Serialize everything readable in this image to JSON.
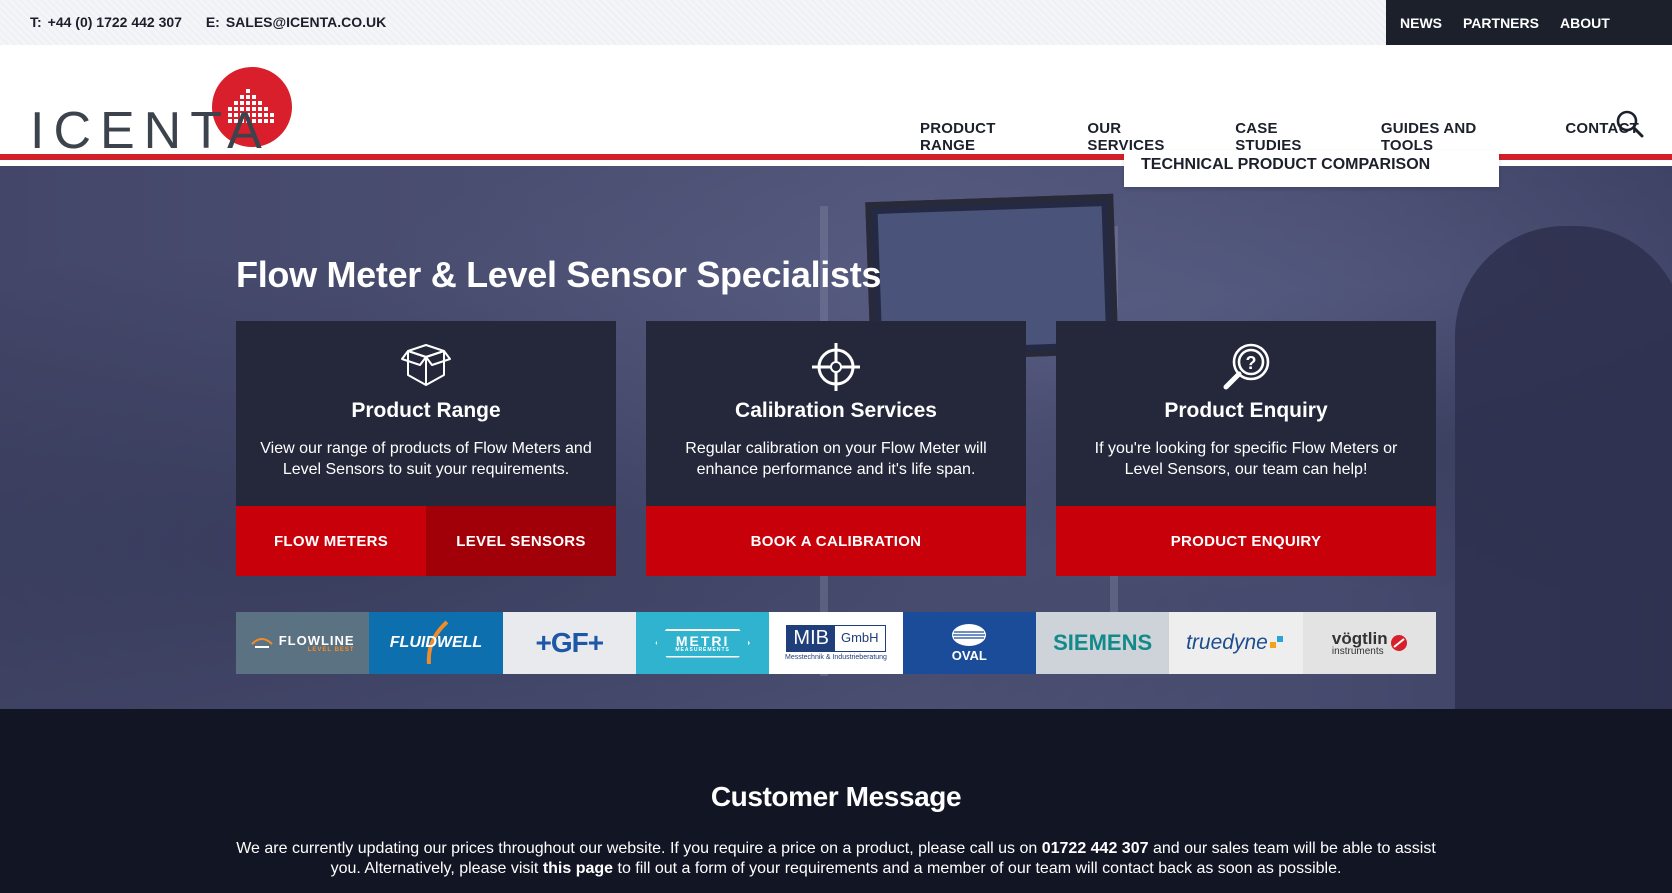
{
  "topbar": {
    "phone_label": "T:",
    "phone": "+44 (0) 1722 442 307",
    "email_label": "E:",
    "email": "SALES@ICENTA.CO.UK",
    "links": [
      "NEWS",
      "PARTNERS",
      "ABOUT"
    ]
  },
  "header": {
    "logo_text": "ICENTA",
    "nav": [
      "PRODUCT RANGE",
      "OUR SERVICES",
      "CASE STUDIES",
      "GUIDES AND TOOLS",
      "CONTACT"
    ],
    "dropdown_item": "TECHNICAL PRODUCT COMPARISON",
    "brand_color": "#d0202a"
  },
  "hero": {
    "title": "Flow Meter & Level Sensor Specialists",
    "cards": [
      {
        "icon": "box-icon",
        "title": "Product Range",
        "text": "View our range of products of Flow Meters and Level Sensors to suit your requirements.",
        "buttons": [
          "FLOW METERS",
          "LEVEL SENSORS"
        ]
      },
      {
        "icon": "crosshair-icon",
        "title": "Calibration Services",
        "text": "Regular calibration on your Flow Meter will enhance performance and it's life span.",
        "buttons": [
          "BOOK A CALIBRATION"
        ]
      },
      {
        "icon": "magnifier-question-icon",
        "title": "Product Enquiry",
        "text": "If you're looking for specific Flow Meters or Level Sensors, our team can help!",
        "buttons": [
          "PRODUCT ENQUIRY"
        ]
      }
    ],
    "partners": [
      {
        "name": "FLOWLINE",
        "sub": "LEVEL BEST",
        "bg": "#5b7283",
        "fg": "#ffffff"
      },
      {
        "name": "FLUIDWELL",
        "bg": "#0e6fae",
        "fg": "#ffffff"
      },
      {
        "name": "+GF+",
        "bg": "#e8eaee",
        "fg": "#1d58a6"
      },
      {
        "name": "METRI",
        "sub": "MEASUREMENTS",
        "bg": "#2fb3cf",
        "fg": "#ffffff"
      },
      {
        "name": "MIB",
        "tag": "GmbH",
        "sub": "Messtechnik & Industrieberatung",
        "bg": "#ffffff",
        "fg": "#1f3e7a"
      },
      {
        "name": "OVAL",
        "bg": "#1b4c9a",
        "fg": "#ffffff"
      },
      {
        "name": "SIEMENS",
        "bg": "#cdd3d9",
        "fg": "#138a8a"
      },
      {
        "name": "truedyne",
        "bg": "#eeeeee",
        "fg": "#1d4d8c"
      },
      {
        "name": "vögtlin",
        "sub": "instruments",
        "bg": "#e3e3e3",
        "fg": "#333333"
      }
    ]
  },
  "message": {
    "title": "Customer Message",
    "line1_a": "We are currently updating our prices throughout our website. If you require a price on a product, please call us on",
    "line1_phone": "01722 442 307",
    "line1_b": "and our sales team will be able to assist you. Alternatively, please visit",
    "link_text": "this page",
    "line1_c": "to fill out a form of your requirements and a member of our team will contact back as soon as possible."
  }
}
